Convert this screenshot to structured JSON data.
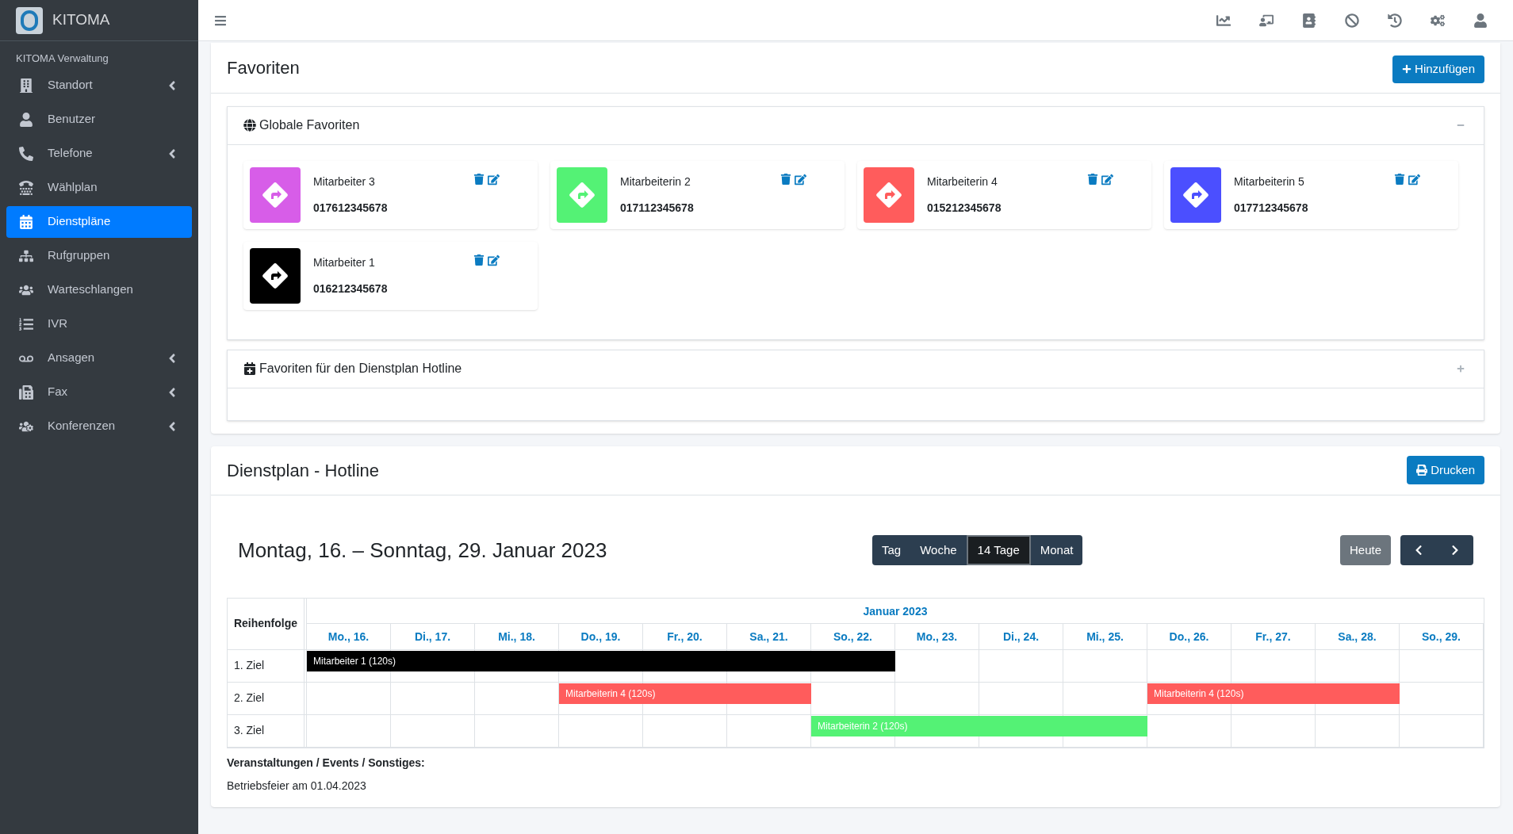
{
  "brand": {
    "name": "KITOMA"
  },
  "sidebar": {
    "section": "KITOMA Verwaltung",
    "items": [
      {
        "kind": "building",
        "label": "Standort",
        "selected": false,
        "submenu": true
      },
      {
        "kind": "user",
        "label": "Benutzer",
        "selected": false,
        "submenu": false
      },
      {
        "kind": "phone",
        "label": "Telefone",
        "selected": false,
        "submenu": true
      },
      {
        "kind": "dialplan",
        "label": "Wählplan",
        "selected": false,
        "submenu": false
      },
      {
        "kind": "calendar",
        "label": "Dienstpläne",
        "selected": true,
        "submenu": false
      },
      {
        "kind": "sitemap",
        "label": "Rufgruppen",
        "selected": false,
        "submenu": false
      },
      {
        "kind": "users",
        "label": "Warteschlangen",
        "selected": false,
        "submenu": false
      },
      {
        "kind": "list",
        "label": "IVR",
        "selected": false,
        "submenu": false
      },
      {
        "kind": "voicemail",
        "label": "Ansagen",
        "selected": false,
        "submenu": true
      },
      {
        "kind": "fax",
        "label": "Fax",
        "selected": false,
        "submenu": true
      },
      {
        "kind": "conference",
        "label": "Konferenzen",
        "selected": false,
        "submenu": true
      }
    ]
  },
  "topbar": {
    "icons": [
      {
        "kind": "chart"
      },
      {
        "kind": "presentation"
      },
      {
        "kind": "contacts"
      },
      {
        "kind": "ban"
      },
      {
        "kind": "history"
      },
      {
        "kind": "cogs"
      },
      {
        "kind": "user"
      }
    ]
  },
  "favorites": {
    "title": "Favoriten",
    "add_button": "Hinzufügen",
    "global": {
      "title": "Globale Favoriten",
      "expanded": true,
      "items": [
        {
          "name": "Mitarbeiter 3",
          "number": "017612345678",
          "color": "#d75de8"
        },
        {
          "name": "Mitarbeiterin 2",
          "number": "017112345678",
          "color": "#54f275"
        },
        {
          "name": "Mitarbeiterin 4",
          "number": "015212345678",
          "color": "#ff5c5c"
        },
        {
          "name": "Mitarbeiterin 5",
          "number": "017712345678",
          "color": "#4b4fff"
        },
        {
          "name": "Mitarbeiter 1",
          "number": "016212345678",
          "color": "#000000"
        }
      ]
    },
    "schedule_favorites": {
      "title": "Favoriten für den Dienstplan Hotline",
      "expanded": false
    }
  },
  "schedule": {
    "title": "Dienstplan - Hotline",
    "print_button": "Drucken",
    "range": "Montag, 16. – Sonntag, 29. Januar 2023",
    "views": [
      {
        "label": "Tag",
        "selected": false
      },
      {
        "label": "Woche",
        "selected": false
      },
      {
        "label": "14 Tage",
        "selected": true
      },
      {
        "label": "Monat",
        "selected": false
      }
    ],
    "today_button": "Heute",
    "order_header": "Reihenfolge",
    "month": "Januar 2023",
    "days": [
      "Mo., 16.",
      "Di., 17.",
      "Mi., 18.",
      "Do., 19.",
      "Fr., 20.",
      "Sa., 21.",
      "So., 22.",
      "Mo., 23.",
      "Di., 24.",
      "Mi., 25.",
      "Do., 26.",
      "Fr., 27.",
      "Sa., 28.",
      "So., 29."
    ],
    "rows": [
      {
        "label": "1. Ziel",
        "cells": [
          {
            "kind": "start",
            "text": "Mitarbeiter 1 (120s)",
            "color": "#000000"
          },
          {
            "kind": "cont"
          },
          {
            "kind": "cont"
          },
          {
            "kind": "cont"
          },
          {
            "kind": "cont"
          },
          {
            "kind": "cont"
          },
          {
            "kind": "cont"
          },
          {
            "kind": "empty"
          },
          {
            "kind": "empty"
          },
          {
            "kind": "empty"
          },
          {
            "kind": "empty"
          },
          {
            "kind": "empty"
          },
          {
            "kind": "empty"
          },
          {
            "kind": "empty"
          }
        ]
      },
      {
        "label": "2. Ziel",
        "cells": [
          {
            "kind": "empty"
          },
          {
            "kind": "empty"
          },
          {
            "kind": "empty"
          },
          {
            "kind": "start",
            "text": "Mitarbeiterin 4 (120s)",
            "color": "#ff5c5c"
          },
          {
            "kind": "cont"
          },
          {
            "kind": "cont"
          },
          {
            "kind": "empty"
          },
          {
            "kind": "empty"
          },
          {
            "kind": "empty"
          },
          {
            "kind": "empty"
          },
          {
            "kind": "start",
            "text": "Mitarbeiterin 4 (120s)",
            "color": "#ff5c5c"
          },
          {
            "kind": "cont"
          },
          {
            "kind": "cont"
          },
          {
            "kind": "empty"
          }
        ]
      },
      {
        "label": "3. Ziel",
        "cells": [
          {
            "kind": "empty"
          },
          {
            "kind": "empty"
          },
          {
            "kind": "empty"
          },
          {
            "kind": "empty"
          },
          {
            "kind": "empty"
          },
          {
            "kind": "empty"
          },
          {
            "kind": "start",
            "text": "Mitarbeiterin 2 (120s)",
            "color": "#54f275"
          },
          {
            "kind": "cont"
          },
          {
            "kind": "cont"
          },
          {
            "kind": "cont"
          },
          {
            "kind": "empty"
          },
          {
            "kind": "empty"
          },
          {
            "kind": "empty"
          },
          {
            "kind": "empty"
          }
        ]
      }
    ],
    "notes_title": "Veranstaltungen / Events / Sonstiges:",
    "notes": "Betriebsfeier am 01.04.2023"
  }
}
